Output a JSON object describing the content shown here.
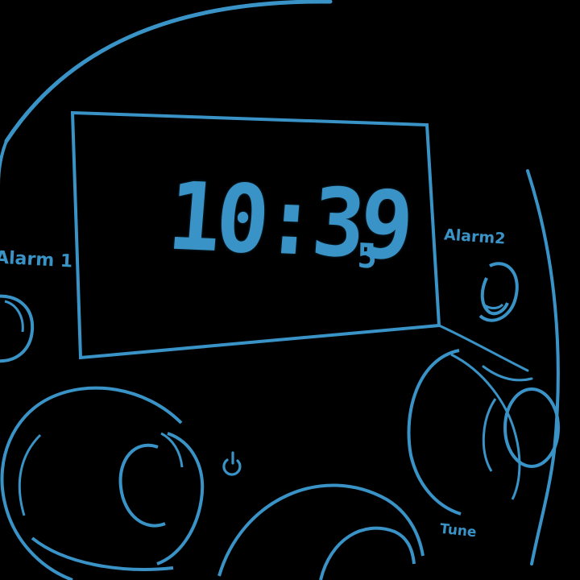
{
  "display": {
    "time": "10:39",
    "seconds": "5"
  },
  "labels": {
    "alarm1": "Alarm 1",
    "alarm2": "Alarm2",
    "tune": "Tune"
  },
  "icons": {
    "power": "power-icon"
  },
  "colors": {
    "accent": "#3a93c6",
    "background": "#000000"
  }
}
